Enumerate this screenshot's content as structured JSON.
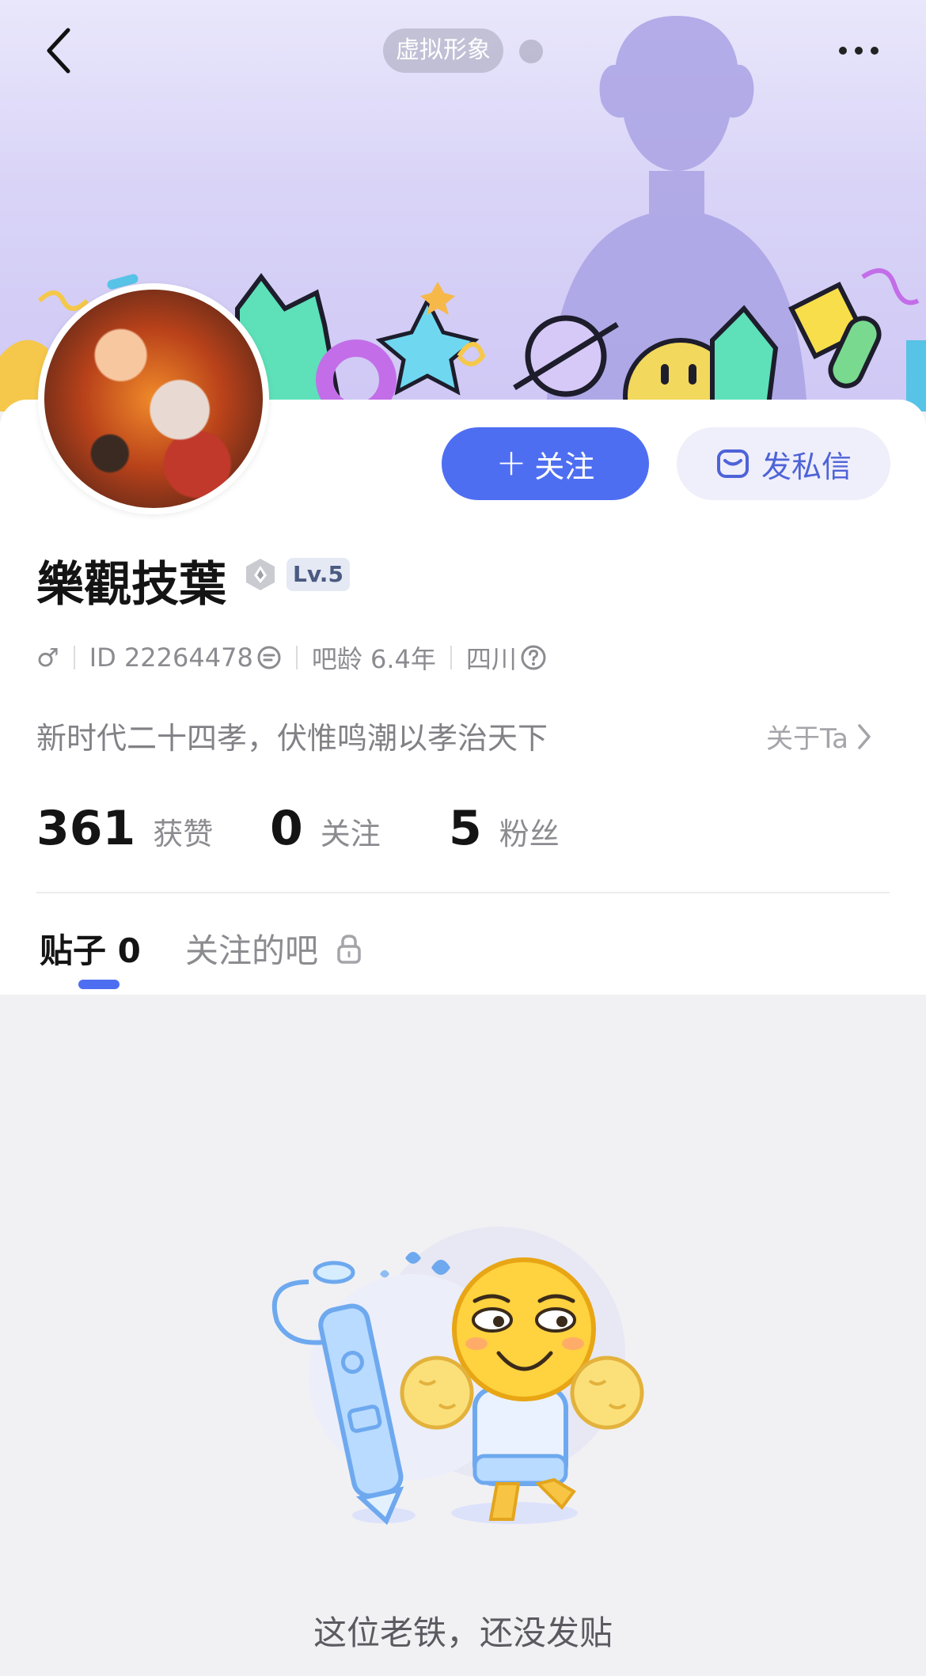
{
  "header": {
    "avatar_pill": "虚拟形象"
  },
  "profile": {
    "username": "樂觀技葉",
    "level": "Lv.5",
    "gender_symbol": "♂",
    "id_text": "ID 22264478",
    "bar_age": "吧龄 6.4年",
    "location": "四川",
    "bio": "新时代二十四孝，伏惟鸣潮以孝治天下",
    "about_label": "关于Ta"
  },
  "actions": {
    "follow_label": "关注",
    "message_label": "发私信"
  },
  "stats": [
    {
      "value": "361",
      "label": "获赞"
    },
    {
      "value": "0",
      "label": "关注"
    },
    {
      "value": "5",
      "label": "粉丝"
    }
  ],
  "tabs": {
    "posts": "贴子 0",
    "followed_bars": "关注的吧"
  },
  "empty_state": {
    "message": "这位老铁，还没发贴"
  },
  "colors": {
    "accent": "#4e6ef2",
    "banner": "#d9d4f7",
    "background": "#f1f1f4"
  }
}
